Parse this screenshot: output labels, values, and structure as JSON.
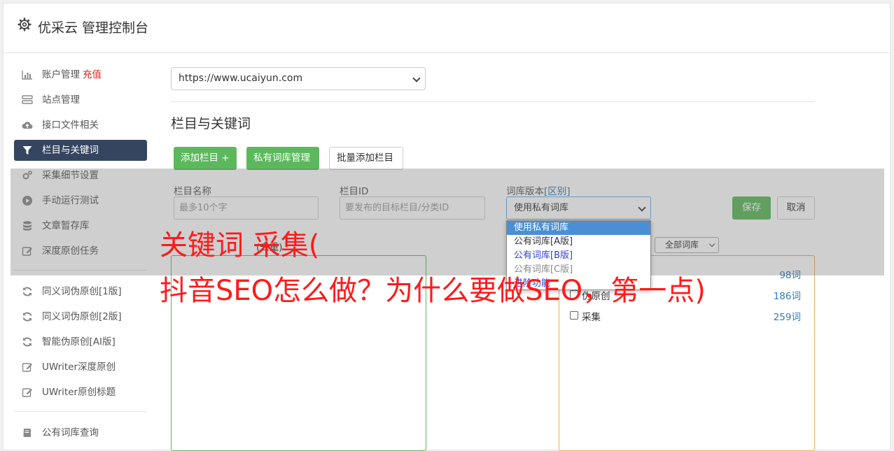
{
  "header": {
    "title": "优采云 管理控制台",
    "icon": "gear-icon"
  },
  "sidebar": {
    "items": [
      {
        "label": "账户管理",
        "extra": "充值",
        "icon": "bar-chart-icon"
      },
      {
        "label": "站点管理",
        "icon": "server-icon"
      },
      {
        "label": "接口文件相关",
        "icon": "cloud-upload-icon"
      },
      {
        "label": "栏目与关键词",
        "icon": "filter-icon",
        "active": true
      },
      {
        "label": "采集细节设置",
        "icon": "cogs-icon"
      },
      {
        "label": "手动运行测试",
        "icon": "play-circle-icon"
      },
      {
        "label": "文章暂存库",
        "icon": "database-icon"
      },
      {
        "label": "深度原创任务",
        "icon": "edit-icon"
      },
      {
        "label": "同义词伪原创[1版]",
        "icon": "refresh-icon"
      },
      {
        "label": "同义词伪原创[2版]",
        "icon": "refresh-icon"
      },
      {
        "label": "智能伪原创[AI版]",
        "icon": "refresh-icon"
      },
      {
        "label": "UWriter深度原创",
        "icon": "edit-icon"
      },
      {
        "label": "UWriter原创标题",
        "icon": "edit-icon"
      },
      {
        "label": "公有词库查询",
        "icon": "book-icon"
      }
    ]
  },
  "main": {
    "site_select": "https://www.ucaiyun.com",
    "section_title": "栏目与关键词",
    "buttons": {
      "add_column": "添加栏目 +",
      "private_lib": "私有词库管理",
      "batch_add": "批量添加栏目"
    },
    "form": {
      "name_label": "栏目名称",
      "name_placeholder": "最多10个字",
      "id_label": "栏目ID",
      "id_placeholder": "要发布的目标栏目/分类ID",
      "lib_label": "词库版本",
      "lib_link": "[区别]",
      "lib_value": "使用私有词库",
      "save": "保存",
      "cancel": "取消"
    },
    "sub_label": "(去重)",
    "lib_filter": "全部词库",
    "dropdown_options": [
      "使用私有词库",
      "公有词库[A版]",
      "公有词库[B版]",
      "公有词库[C版]",
      "进阶功能"
    ],
    "words": [
      {
        "name": "",
        "count": "98词"
      },
      {
        "name": "伪原创",
        "count": "186词"
      },
      {
        "name": "采集",
        "count": "259词"
      }
    ]
  },
  "watermark": {
    "line1": "关键词 采集(",
    "line2": "抖音SEO怎么做？为什么要做SEO，第一点)"
  },
  "colors": {
    "active_nav": "#36455f",
    "green": "#5cb85c",
    "link": "#337ab7",
    "watermark": "#ff1a1a"
  }
}
